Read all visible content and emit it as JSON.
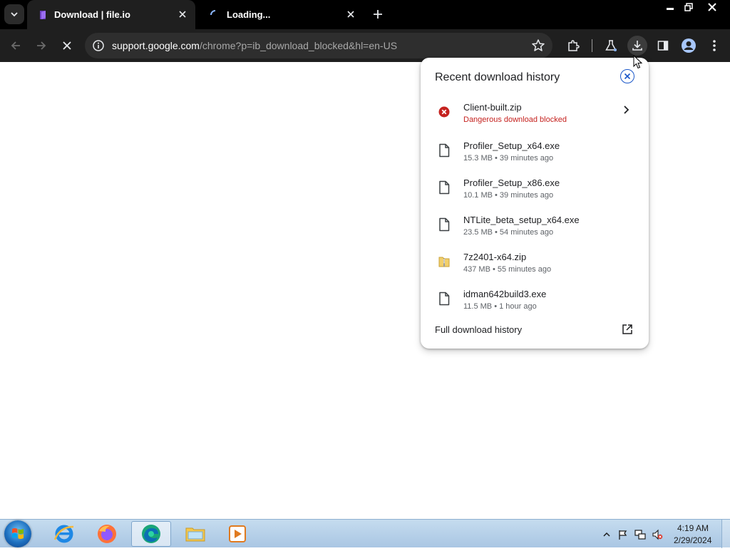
{
  "tabs": [
    {
      "title": "Download | file.io",
      "icon": "fileio-favicon-icon",
      "active": true
    },
    {
      "title": "Loading...",
      "icon": "loading-spinner-icon",
      "active": false
    }
  ],
  "omnibox": {
    "host": "support.google.com",
    "path": "/chrome?p=ib_download_blocked&hl=en-US"
  },
  "downloads": {
    "title": "Recent download history",
    "items": [
      {
        "name": "Client-built.zip",
        "meta": "Dangerous download blocked",
        "icon": "warning-error-icon",
        "status": "danger"
      },
      {
        "name": "Profiler_Setup_x64.exe",
        "meta": "15.3 MB • 39 minutes ago",
        "icon": "file-icon"
      },
      {
        "name": "Profiler_Setup_x86.exe",
        "meta": "10.1 MB • 39 minutes ago",
        "icon": "file-icon"
      },
      {
        "name": "NTLite_beta_setup_x64.exe",
        "meta": "23.5 MB • 54 minutes ago",
        "icon": "file-icon"
      },
      {
        "name": "7z2401-x64.zip",
        "meta": "437 MB • 55 minutes ago",
        "icon": "zip-folder-icon"
      },
      {
        "name": "idman642build3.exe",
        "meta": "11.5 MB • 1 hour ago",
        "icon": "file-icon"
      }
    ],
    "footer_label": "Full download history"
  },
  "taskbar": {
    "apps": [
      "internet-explorer-icon",
      "firefox-icon",
      "edge-icon",
      "file-explorer-icon",
      "media-player-icon"
    ],
    "time": "4:19 AM",
    "date": "2/29/2024"
  },
  "colors": {
    "danger": "#c5221f",
    "accent": "#1a57c9",
    "toolbar": "#1f1f1f",
    "tabstrip": "#000000"
  }
}
